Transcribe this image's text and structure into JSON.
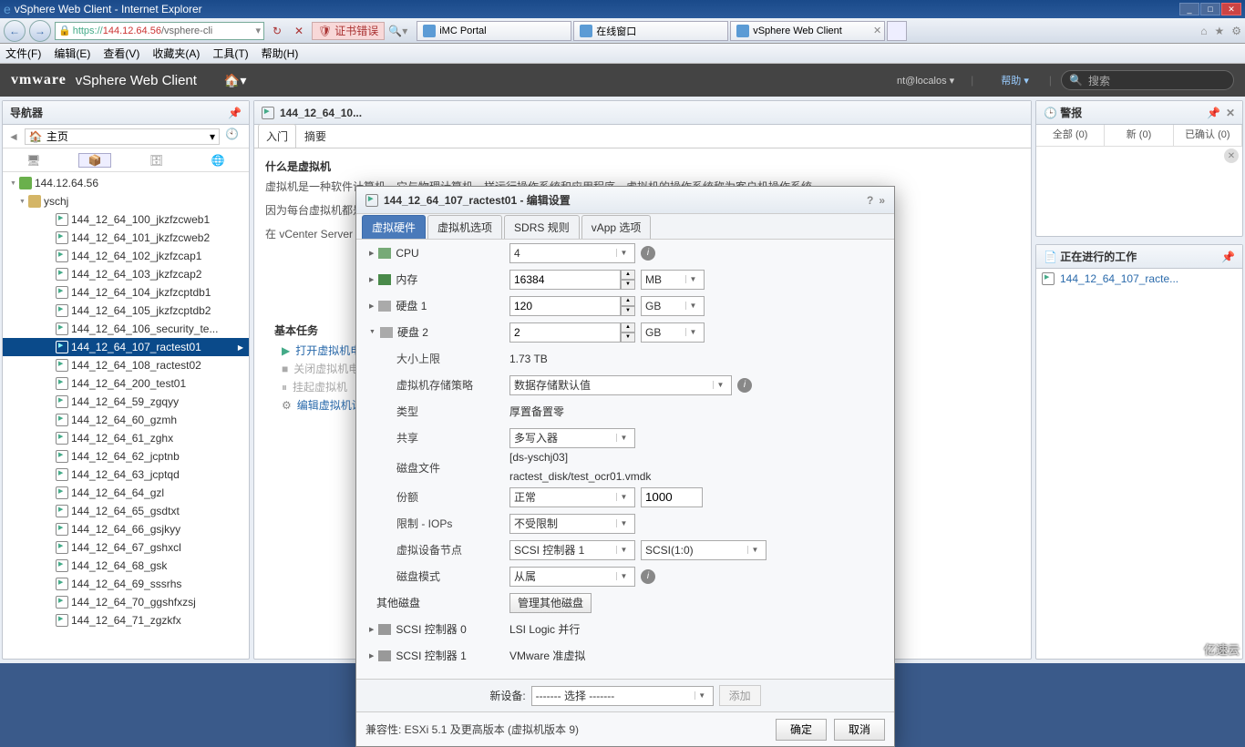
{
  "ie": {
    "title": "vSphere Web Client - Internet Explorer",
    "url_scheme": "https://",
    "url_host": "144.12.64.56",
    "url_path": "/vsphere-cli",
    "cert_error": "证书错误",
    "tabs": [
      "iMC Portal",
      "在线窗口",
      "vSphere Web Client"
    ],
    "menus": [
      "文件(F)",
      "编辑(E)",
      "查看(V)",
      "收藏夹(A)",
      "工具(T)",
      "帮助(H)"
    ]
  },
  "header": {
    "logo": "vmware",
    "title": "vSphere Web Client",
    "user": "nt@localos",
    "help": "帮助",
    "search_placeholder": "搜索"
  },
  "navigator": {
    "title": "导航器",
    "home": "主页",
    "vcenter": "144.12.64.56",
    "datacenter": "yschj",
    "vms": [
      "144_12_64_100_jkzfzcweb1",
      "144_12_64_101_jkzfzcweb2",
      "144_12_64_102_jkzfzcap1",
      "144_12_64_103_jkzfzcap2",
      "144_12_64_104_jkzfzcptdb1",
      "144_12_64_105_jkzfzcptdb2",
      "144_12_64_106_security_te...",
      "144_12_64_107_ractest01",
      "144_12_64_108_ractest02",
      "144_12_64_200_test01",
      "144_12_64_59_zgqyy",
      "144_12_64_60_gzmh",
      "144_12_64_61_zghx",
      "144_12_64_62_jcptnb",
      "144_12_64_63_jcptqd",
      "144_12_64_64_gzl",
      "144_12_64_65_gsdtxt",
      "144_12_64_66_gsjkyy",
      "144_12_64_67_gshxcl",
      "144_12_64_68_gsk",
      "144_12_64_69_sssrhs",
      "144_12_64_70_ggshfxzsj",
      "144_12_64_71_zgzkfx"
    ],
    "selected_index": 7
  },
  "center": {
    "vm_title": "144_12_64_10...",
    "tabs": [
      "入门",
      "摘要"
    ],
    "intro_heading": "什么是虚拟机",
    "intro_p1": "虚拟机是一种软件计算机，它与物理计算机一样运行操作系统和应用程序。虚拟机的操作系统称为客户机操作系统。",
    "intro_p2": "因为每台虚拟机都是一个隔离的计算环境，所以将虚拟机用作桌面或工作站环境、测试环境或用来整合服务器应用程序。",
    "intro_p3": "在 vCenter Server 中，虚拟机在主机或群集上运行。同一台主机可以运行许多虚拟机。",
    "basic_tasks": "基本任务",
    "task_power_on": "打开虚拟机电源",
    "task_power_off": "关闭虚拟机电源",
    "task_suspend": "挂起虚拟机",
    "task_edit": "编辑虚拟机设置"
  },
  "alarms": {
    "title": "警报",
    "tabs": [
      "全部 (0)",
      "新 (0)",
      "已确认 (0)"
    ]
  },
  "wip": {
    "title": "正在进行的工作",
    "items": [
      "144_12_64_107_racte..."
    ]
  },
  "dialog": {
    "title": "144_12_64_107_ractest01 - 编辑设置",
    "tabs": [
      "虚拟硬件",
      "虚拟机选项",
      "SDRS 规则",
      "vApp 选项"
    ],
    "cpu_label": "CPU",
    "cpu_value": "4",
    "mem_label": "内存",
    "mem_value": "16384",
    "mem_unit": "MB",
    "disk1_label": "硬盘 1",
    "disk1_value": "120",
    "disk1_unit": "GB",
    "disk2_label": "硬盘 2",
    "disk2_value": "2",
    "disk2_unit": "GB",
    "size_limit_lbl": "大小上限",
    "size_limit_val": "1.73 TB",
    "storage_policy_lbl": "虚拟机存储策略",
    "storage_policy_val": "数据存储默认值",
    "type_lbl": "类型",
    "type_val": "厚置备置零",
    "share_lbl": "共享",
    "share_val": "多写入器",
    "diskfile_lbl": "磁盘文件",
    "diskfile_val1": "[ds-yschj03]",
    "diskfile_val2": "ractest_disk/test_ocr01.vmdk",
    "shares_lbl": "份额",
    "shares_val": "正常",
    "shares_num": "1000",
    "iops_lbl": "限制 - IOPs",
    "iops_val": "不受限制",
    "vdev_lbl": "虚拟设备节点",
    "vdev_ctrl": "SCSI 控制器 1",
    "vdev_pos": "SCSI(1:0)",
    "diskmode_lbl": "磁盘模式",
    "diskmode_val": "从属",
    "other_disks_lbl": "其他磁盘",
    "manage_other": "管理其他磁盘",
    "scsi0_lbl": "SCSI 控制器 0",
    "scsi0_val": "LSI Logic 并行",
    "scsi1_lbl": "SCSI 控制器 1",
    "scsi1_val": "VMware 准虚拟",
    "new_device_lbl": "新设备:",
    "new_device_sel": "------- 选择 -------",
    "add_btn": "添加",
    "compat": "兼容性: ESXi 5.1 及更高版本 (虚拟机版本 9)",
    "ok": "确定",
    "cancel": "取消"
  },
  "watermark": "亿速云"
}
